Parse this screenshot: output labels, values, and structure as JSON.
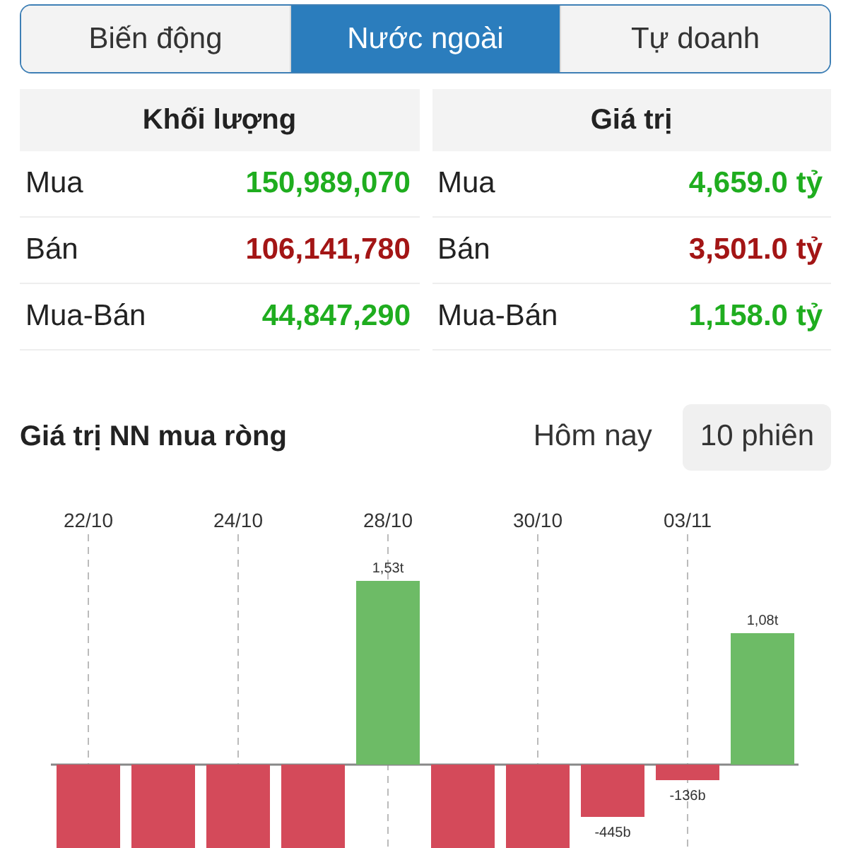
{
  "tabs": [
    {
      "label": "Biến động",
      "selected": false
    },
    {
      "label": "Nước ngoài",
      "selected": true
    },
    {
      "label": "Tự doanh",
      "selected": false
    }
  ],
  "tables": [
    {
      "title": "Khối lượng",
      "rows": [
        {
          "label": "Mua",
          "value": "150,989,070",
          "kind": "up"
        },
        {
          "label": "Bán",
          "value": "106,141,780",
          "kind": "down"
        },
        {
          "label": "Mua-Bán",
          "value": "44,847,290",
          "kind": "up"
        }
      ]
    },
    {
      "title": "Giá trị",
      "rows": [
        {
          "label": "Mua",
          "value": "4,659.0 tỷ",
          "kind": "up"
        },
        {
          "label": "Bán",
          "value": "3,501.0 tỷ",
          "kind": "down"
        },
        {
          "label": "Mua-Bán",
          "value": "1,158.0 tỷ",
          "kind": "up"
        }
      ]
    }
  ],
  "chart": {
    "title": "Giá trị NN mua ròng",
    "periods": [
      {
        "label": "Hôm nay",
        "selected": false
      },
      {
        "label": "10 phiên",
        "selected": true
      }
    ],
    "bars": [
      {
        "kind": "down",
        "date": "22/10"
      },
      {
        "kind": "down"
      },
      {
        "kind": "down",
        "date": "24/10"
      },
      {
        "kind": "down"
      },
      {
        "kind": "up",
        "date": "28/10",
        "label": "1,53t"
      },
      {
        "kind": "down"
      },
      {
        "kind": "down",
        "date": "30/10"
      },
      {
        "kind": "down",
        "label": "-445b"
      },
      {
        "kind": "down",
        "date": "03/11",
        "label": "-136b"
      },
      {
        "kind": "up",
        "label": "1,08t"
      }
    ]
  }
}
